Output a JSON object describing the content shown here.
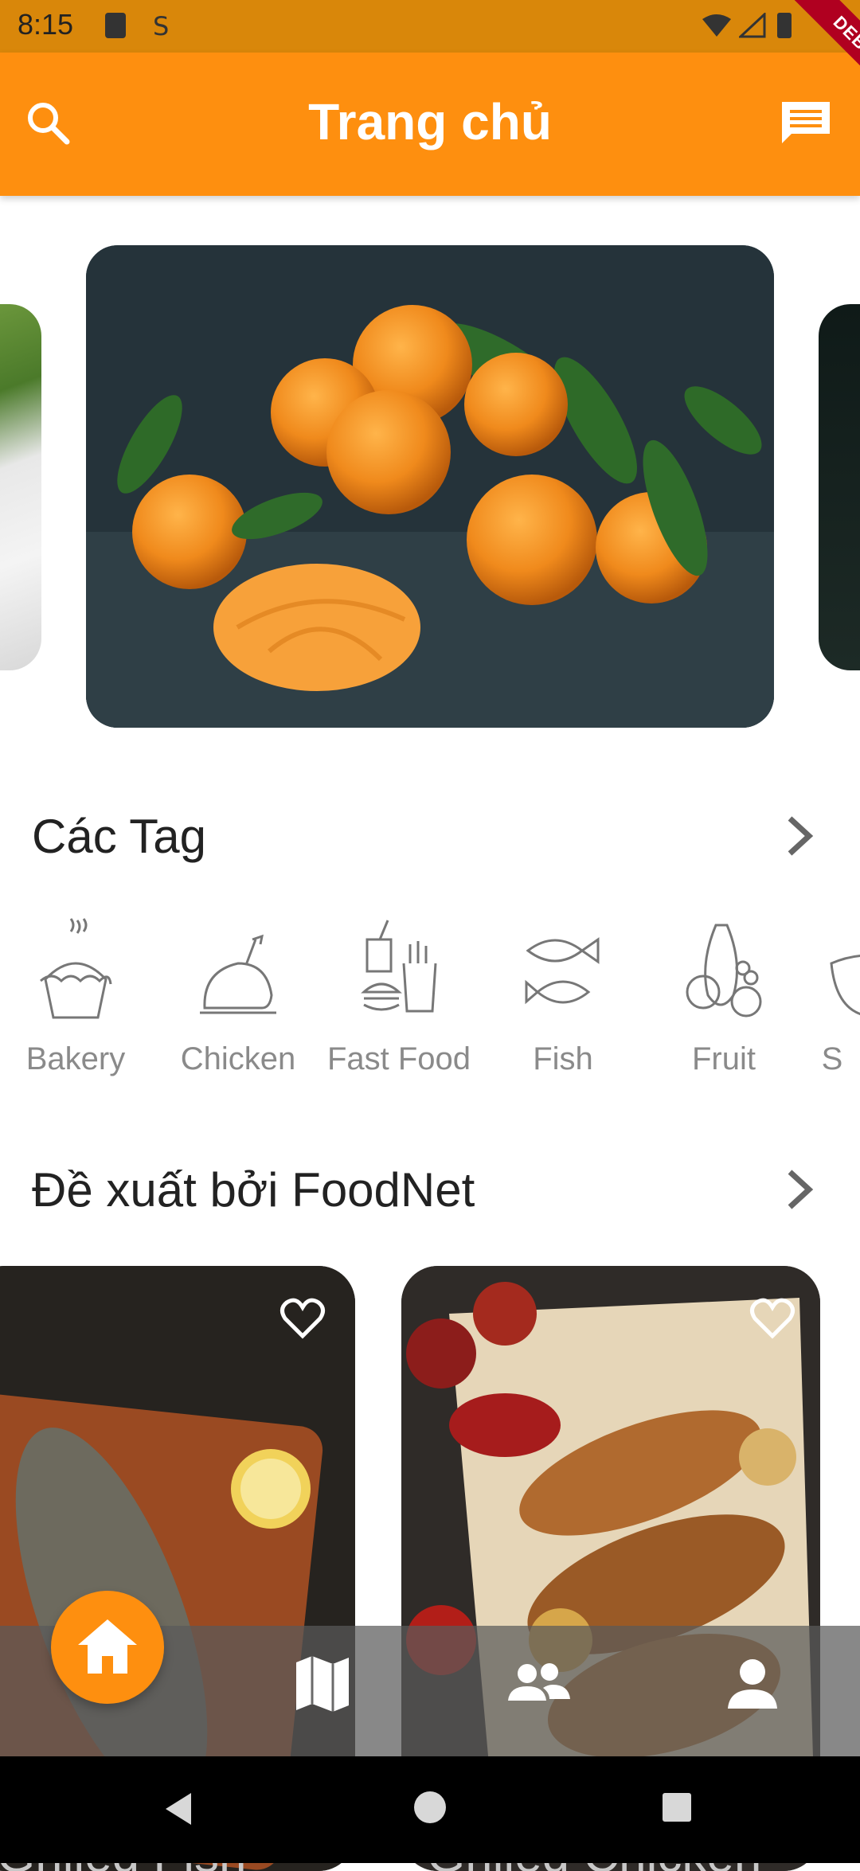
{
  "status_bar": {
    "time": "8:15",
    "icons": [
      "sd-card-icon",
      "sync-icon",
      "wifi-icon",
      "signal-icon",
      "battery-icon"
    ]
  },
  "debug_banner": "DEBUG",
  "app_bar": {
    "title": "Trang chủ",
    "left_icon": "search-icon",
    "right_icon": "chat-icon",
    "color": "#fe8f0f"
  },
  "carousel": {
    "images": [
      "salad-image",
      "tangerines-image",
      "dark-plate-image"
    ],
    "active_index": 1
  },
  "tags_section": {
    "title": "Các Tag",
    "items": [
      {
        "label": "Bakery",
        "icon": "cake-icon"
      },
      {
        "label": "Chicken",
        "icon": "roast-chicken-icon"
      },
      {
        "label": "Fast Food",
        "icon": "fast-food-icon"
      },
      {
        "label": "Fish",
        "icon": "fish-icon"
      },
      {
        "label": "Fruit",
        "icon": "fruit-icon"
      },
      {
        "label": "S",
        "icon": "soup-icon"
      }
    ]
  },
  "recommended_section": {
    "title": "Đề xuất bởi FoodNet",
    "items": [
      {
        "title": "Grilled Fish",
        "icon": "heart-outline-icon"
      },
      {
        "title": "Grilled Chicken",
        "icon": "heart-outline-icon"
      }
    ]
  },
  "bottom_nav": {
    "items": [
      {
        "icon": "home-icon",
        "active": true
      },
      {
        "icon": "map-icon",
        "active": false
      },
      {
        "icon": "people-icon",
        "active": false
      },
      {
        "icon": "person-icon",
        "active": false
      }
    ]
  }
}
